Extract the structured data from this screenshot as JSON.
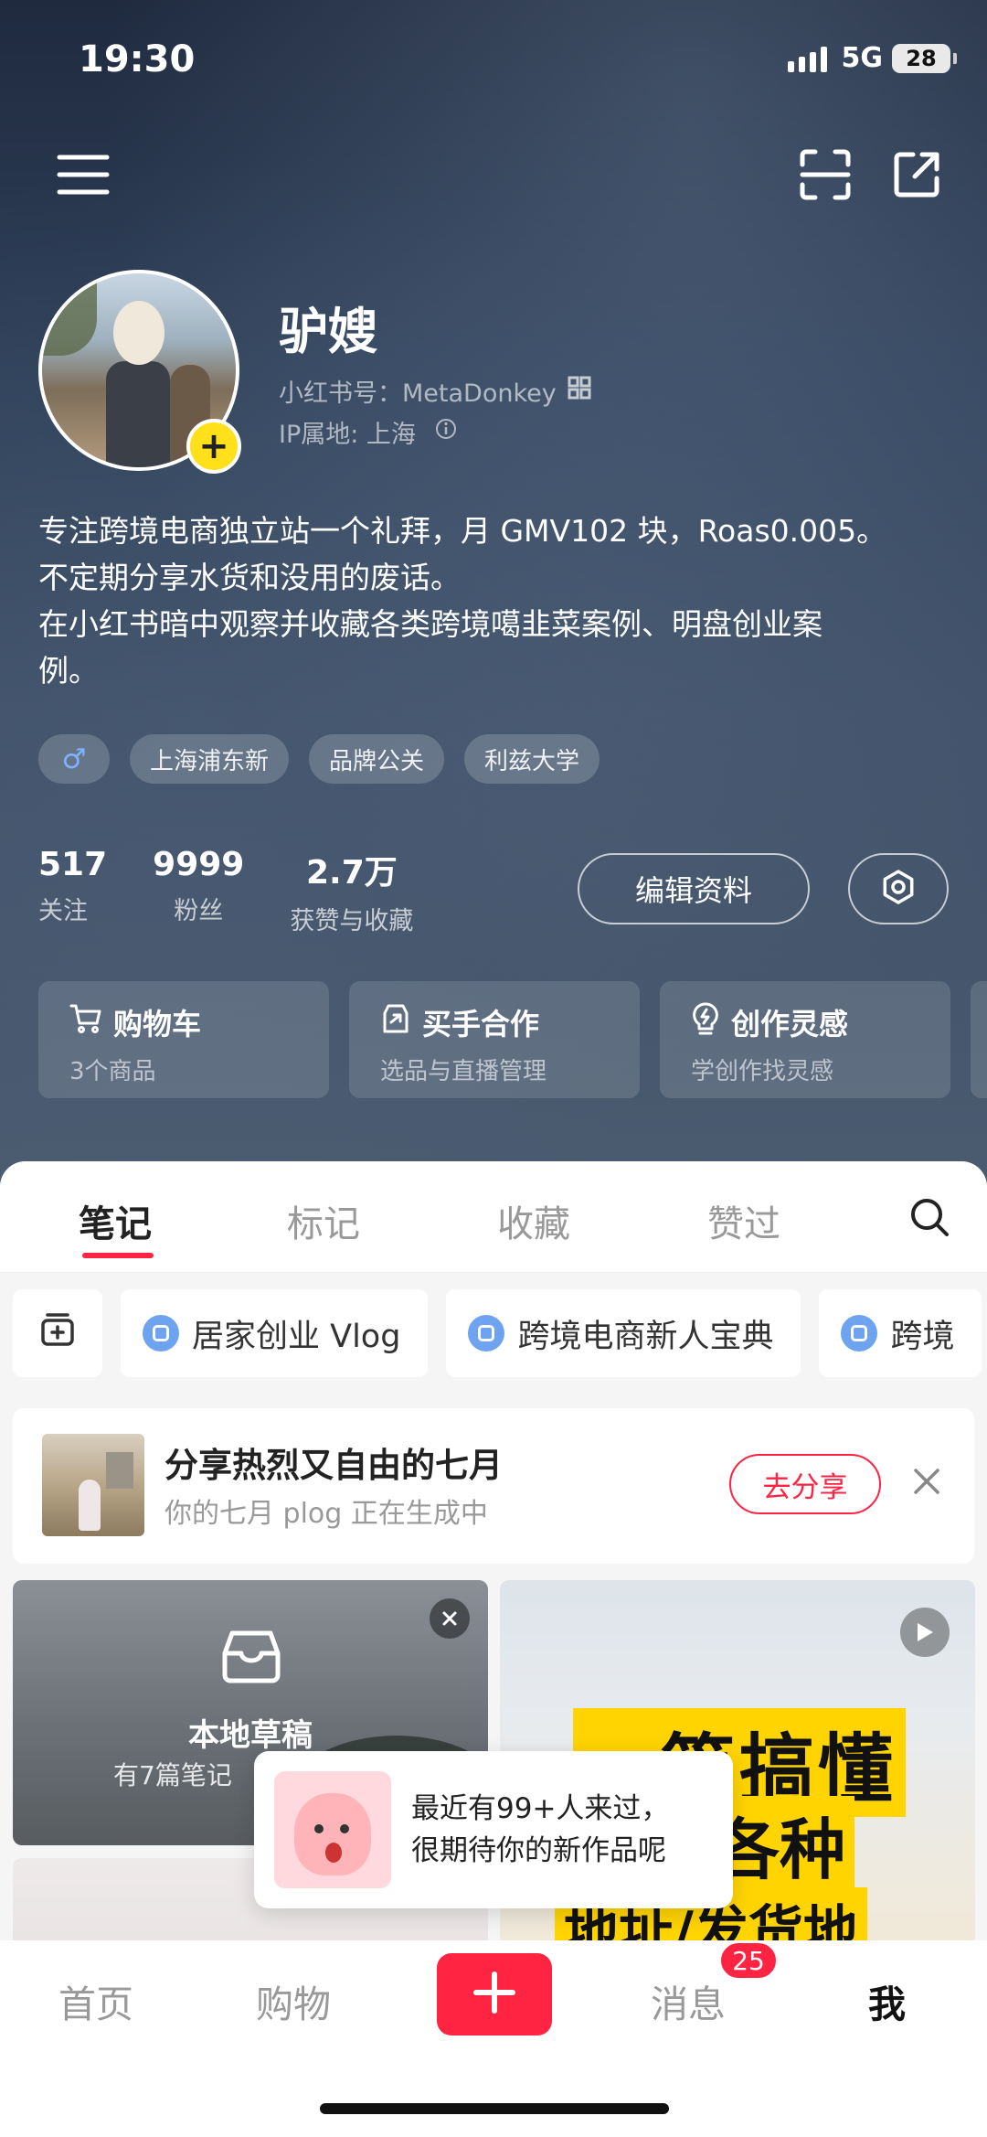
{
  "status_bar": {
    "time": "19:30",
    "network": "5G",
    "battery": "28"
  },
  "profile": {
    "nickname": "驴嫂",
    "account_id": "小红书号：MetaDonkey",
    "ip_location": "IP属地: 上海",
    "bio": [
      "专注跨境电商独立站一个礼拜，月 GMV102 块，Roas0.005。",
      "不定期分享水货和没用的废话。",
      "在小红书暗中观察并收藏各类跨境噶韭菜案例、明盘创业案",
      "例。"
    ],
    "tags": [
      "上海浦东新",
      "品牌公关",
      "利兹大学"
    ],
    "stats": [
      {
        "value": "517",
        "label": "关注"
      },
      {
        "value": "9999",
        "label": "粉丝"
      },
      {
        "value": "2.7万",
        "label": "获赞与收藏"
      }
    ],
    "edit_label": "编辑资料"
  },
  "feature_cards": [
    {
      "title": "购物车",
      "sub": "3个商品",
      "icon": "cart-icon"
    },
    {
      "title": "买手合作",
      "sub": "选品与直播管理",
      "icon": "bag-icon"
    },
    {
      "title": "创作灵感",
      "sub": "学创作找灵感",
      "icon": "bulb-icon"
    }
  ],
  "tabs": [
    "笔记",
    "标记",
    "收藏",
    "赞过"
  ],
  "collections": [
    "居家创业 Vlog",
    "跨境电商新人宝典",
    "跨境"
  ],
  "plog": {
    "title": "分享热烈又自由的七月",
    "sub": "你的七月 plog 正在生成中",
    "button": "去分享"
  },
  "draft": {
    "title": "本地草稿",
    "sub": "有7篇笔记"
  },
  "post": {
    "line1": "一篇搞懂",
    "line2": "设置各种",
    "line3": "地址/发货地"
  },
  "toast": {
    "line1": "最近有99+人来过，",
    "line2": "很期待你的新作品呢"
  },
  "bottom_nav": {
    "home": "首页",
    "shop": "购物",
    "messages": "消息",
    "me": "我",
    "badge": "25"
  },
  "colors": {
    "accent": "#ff2442",
    "avatar_badge": "#ffe01b"
  }
}
